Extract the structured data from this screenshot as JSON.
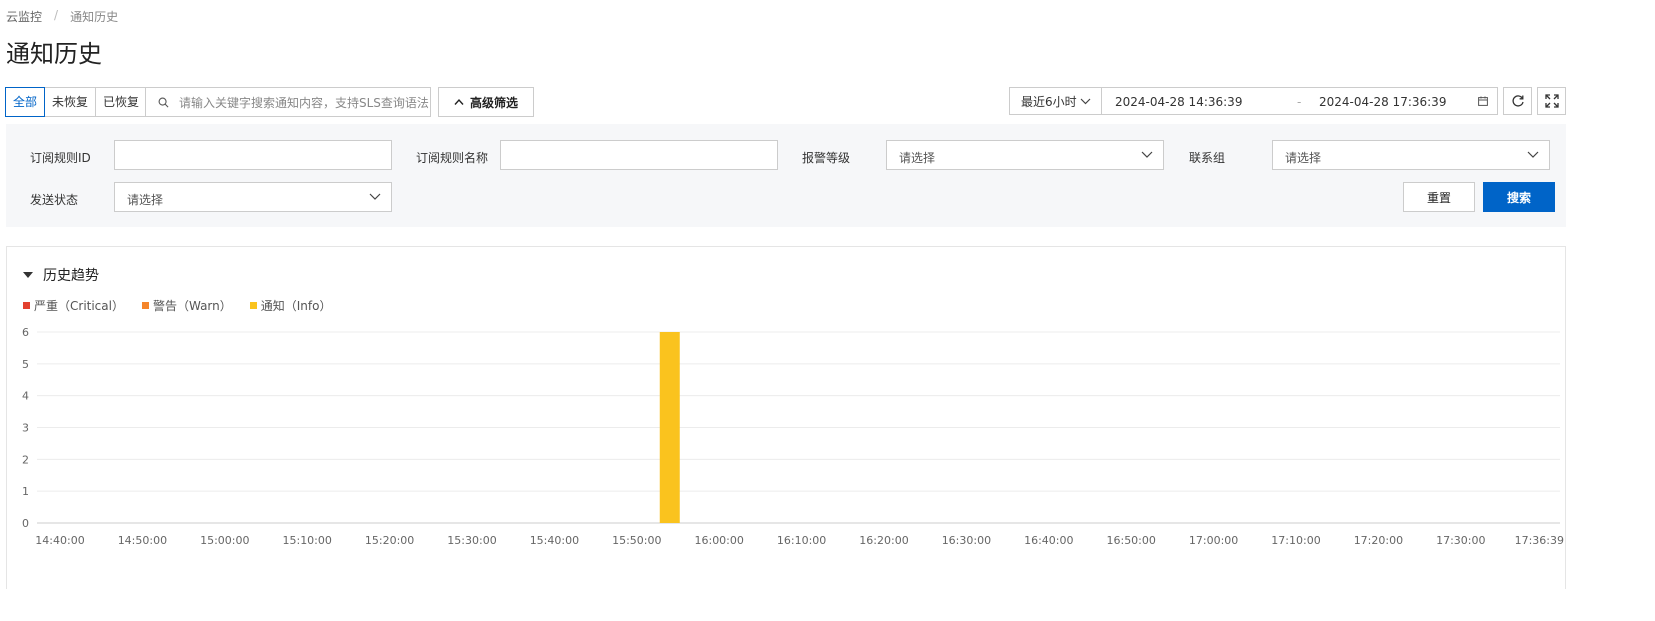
{
  "breadcrumb": {
    "parent": "云监控",
    "separator": "/",
    "current": "通知历史"
  },
  "page_title": "通知历史",
  "status_filter": {
    "options": [
      "全部",
      "未恢复",
      "已恢复"
    ],
    "active_index": 0
  },
  "search": {
    "placeholder": "请输入关键字搜索通知内容，支持SLS查询语法"
  },
  "advanced_filter_label": "高级筛选",
  "time_range": {
    "preset": "最近6小时",
    "start": "2024-04-28 14:36:39",
    "separator": "-",
    "end": "2024-04-28 17:36:39"
  },
  "filters": {
    "rule_id_label": "订阅规则ID",
    "rule_name_label": "订阅规则名称",
    "alert_level_label": "报警等级",
    "alert_level_placeholder": "请选择",
    "contact_group_label": "联系组",
    "contact_group_placeholder": "请选择",
    "send_status_label": "发送状态",
    "send_status_placeholder": "请选择",
    "reset_label": "重置",
    "search_label": "搜索"
  },
  "chart": {
    "section_title": "历史趋势"
  },
  "colors": {
    "accent": "#0064c8",
    "critical": "#e3412f",
    "warn": "#f5852a",
    "info": "#fac31e"
  },
  "chart_data": {
    "type": "bar",
    "stacked": true,
    "title": "",
    "xlabel": "",
    "ylabel": "",
    "ylim": [
      0,
      6
    ],
    "yticks": [
      "0",
      "1",
      "2",
      "3",
      "4",
      "5",
      "6"
    ],
    "x_ticks": [
      "14:40:00",
      "14:50:00",
      "15:00:00",
      "15:10:00",
      "15:20:00",
      "15:30:00",
      "15:40:00",
      "15:50:00",
      "16:00:00",
      "16:10:00",
      "16:20:00",
      "16:30:00",
      "16:40:00",
      "16:50:00",
      "17:00:00",
      "17:10:00",
      "17:20:00",
      "17:30:00",
      "17:36:39"
    ],
    "legend_position": "top-left",
    "grid": true,
    "series": [
      {
        "name": "严重（Critical）",
        "color": "#e3412f",
        "points": []
      },
      {
        "name": "警告（Warn）",
        "color": "#f5852a",
        "points": []
      },
      {
        "name": "通知（Info）",
        "color": "#fac31e",
        "points": [
          {
            "x": "15:54:00",
            "y": 6
          }
        ]
      }
    ]
  }
}
